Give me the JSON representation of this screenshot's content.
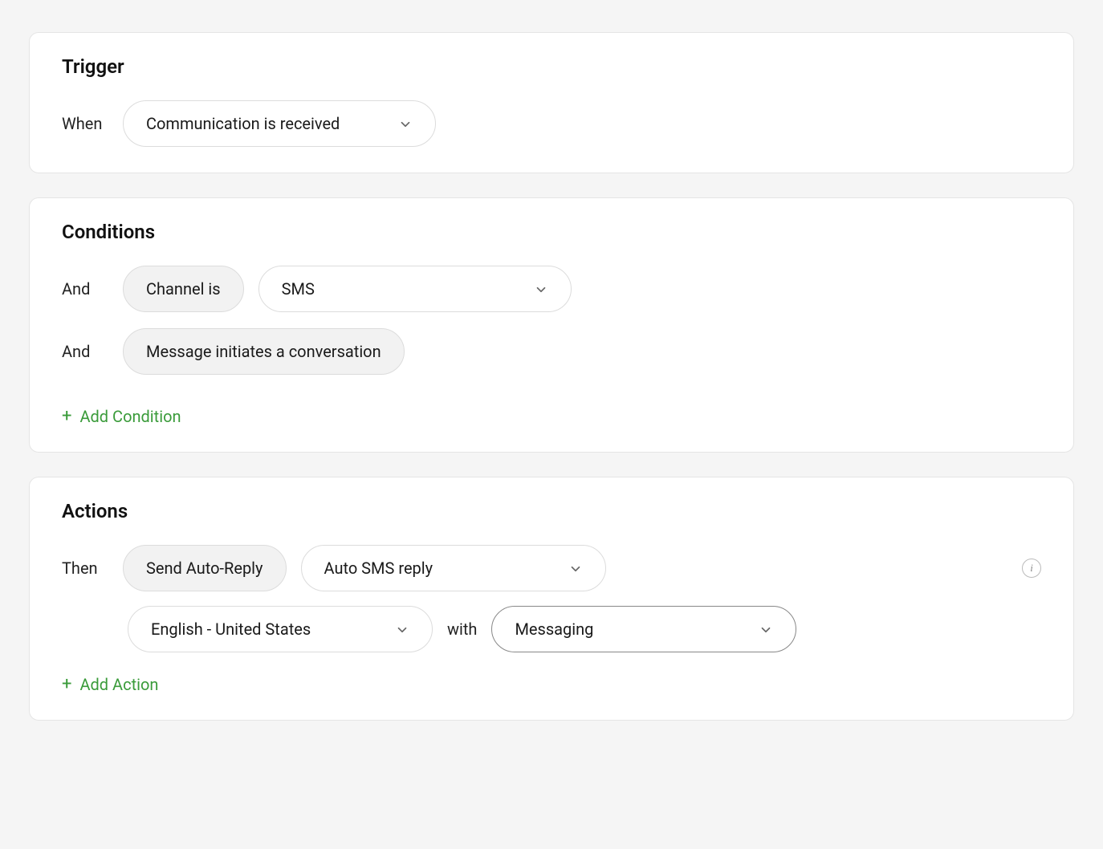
{
  "trigger": {
    "title": "Trigger",
    "when_label": "When",
    "when_value": "Communication is received"
  },
  "conditions": {
    "title": "Conditions",
    "rows": [
      {
        "operator": "And",
        "pill_label": "Channel is",
        "value": "SMS"
      },
      {
        "operator": "And",
        "pill_label": "Message initiates a conversation"
      }
    ],
    "add_label": "Add Condition"
  },
  "actions": {
    "title": "Actions",
    "then_label": "Then",
    "action_type": "Send Auto-Reply",
    "template": "Auto SMS reply",
    "language": "English - United States",
    "with_label": "with",
    "channel": "Messaging",
    "add_label": "Add Action"
  }
}
